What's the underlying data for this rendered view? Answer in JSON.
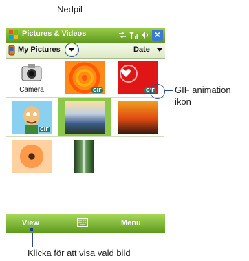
{
  "annotations": {
    "top": "Nedpil",
    "right_line1": "GIF animation",
    "right_line2": "ikon",
    "bottom": "Klicka för att visa vald bild"
  },
  "titlebar": {
    "title": "Pictures & Videos",
    "close_label": "×"
  },
  "toolbar": {
    "folder": "My Pictures",
    "sort": "Date"
  },
  "grid": {
    "camera_label": "Camera",
    "gif_badge": "GIF"
  },
  "softbar": {
    "left": "View",
    "right": "Menu"
  },
  "colors": {
    "accent_green": "#7ab53a",
    "callout_line": "#2a4a8a"
  }
}
